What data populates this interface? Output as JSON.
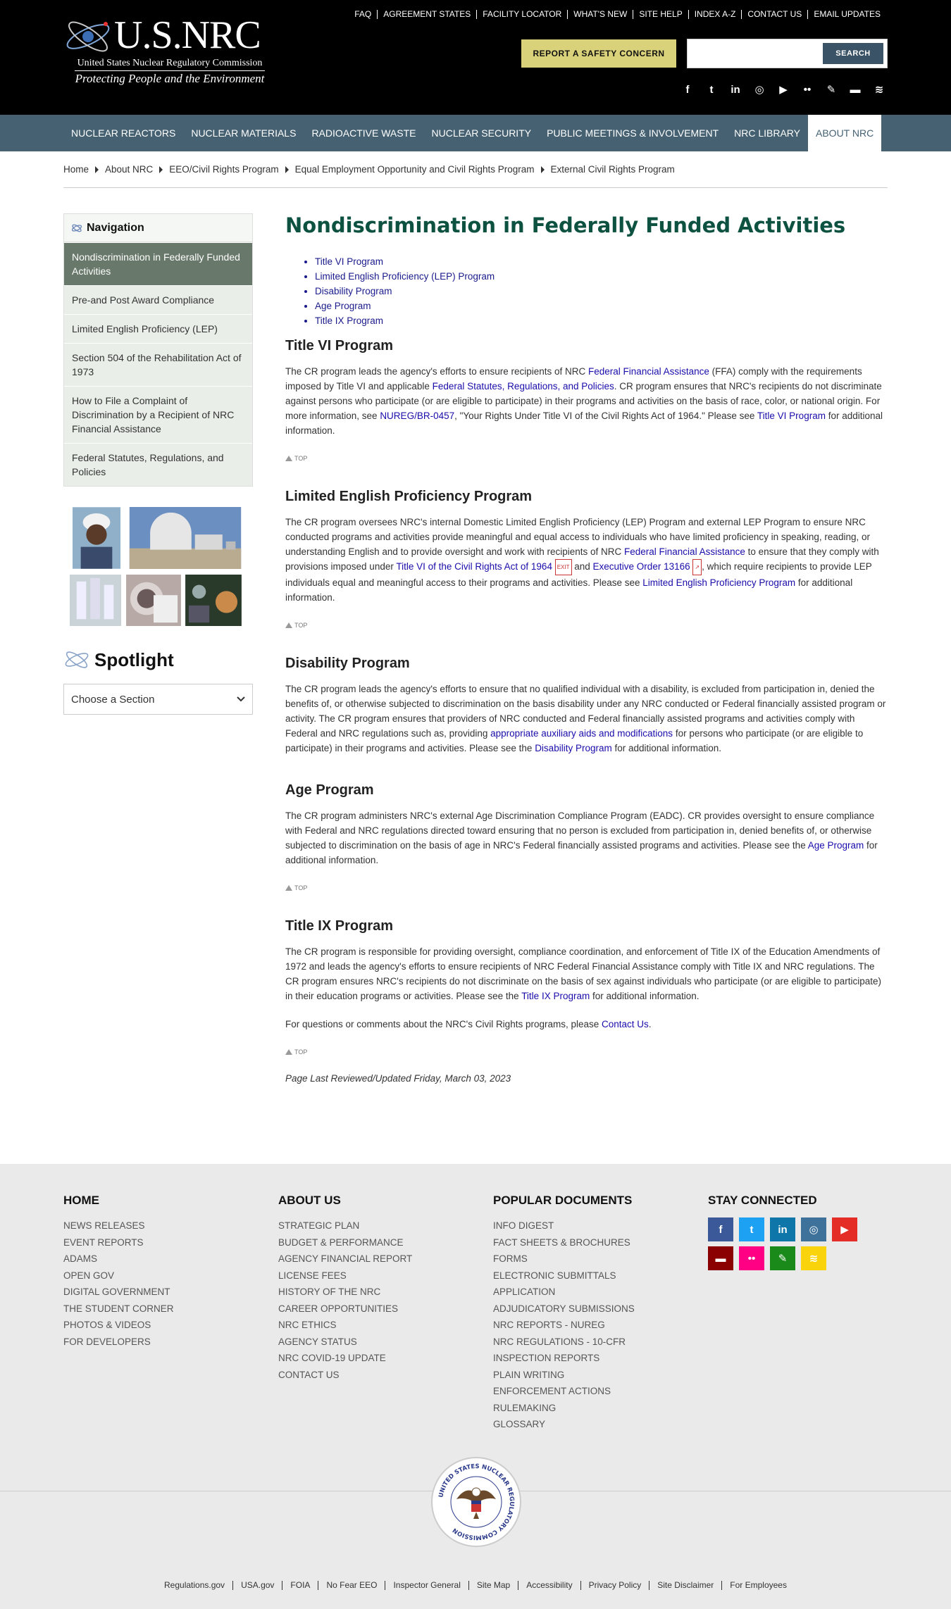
{
  "header": {
    "logo_title": "U.S.NRC",
    "logo_subtitle": "United States Nuclear Regulatory Commission",
    "logo_tagline": "Protecting People and the Environment",
    "utility_links": [
      "FAQ",
      "AGREEMENT STATES",
      "FACILITY LOCATOR",
      "WHAT'S NEW",
      "SITE HELP",
      "INDEX A-Z",
      "CONTACT US",
      "EMAIL UPDATES"
    ],
    "report_button": "REPORT A SAFETY CONCERN",
    "search_placeholder": "",
    "search_button": "SEARCH",
    "social_icons": [
      "facebook-icon",
      "twitter-icon",
      "linkedin-icon",
      "instagram-icon",
      "youtube-icon",
      "flickr-icon",
      "blog-icon",
      "chat-icon",
      "rss-icon"
    ]
  },
  "navbar": {
    "items": [
      "NUCLEAR REACTORS",
      "NUCLEAR MATERIALS",
      "RADIOACTIVE WASTE",
      "NUCLEAR SECURITY",
      "PUBLIC MEETINGS & INVOLVEMENT",
      "NRC LIBRARY",
      "ABOUT NRC"
    ],
    "active_index": 6
  },
  "breadcrumb": [
    "Home",
    "About NRC",
    "EEO/Civil Rights Program",
    "Equal Employment Opportunity and Civil Rights Program",
    "External Civil Rights Program"
  ],
  "sidebar": {
    "nav_title": "Navigation",
    "links": [
      "Nondiscrimination in Federally Funded Activities",
      "Pre-and Post Award Compliance",
      "Limited English Proficiency (LEP)",
      "Section 504 of the Rehabilitation Act of 1973",
      "How to File a Complaint of Discrimination by a Recipient of NRC Financial Assistance",
      "Federal Statutes, Regulations, and Policies"
    ],
    "spotlight_title": "Spotlight",
    "spotlight_select": "Choose a Section"
  },
  "content": {
    "title": "Nondiscrimination in Federally Funded Activities",
    "toc": [
      "Title VI Program",
      "Limited English Proficiency (LEP) Program",
      "Disability Program",
      "Age Program",
      "Title IX Program"
    ],
    "top_label": "TOP",
    "ext_label": "EXIT",
    "title6": {
      "heading": "Title VI Program",
      "t1": "The CR program leads the agency's efforts to ensure recipients of NRC ",
      "l1": "Federal Financial Assistance",
      "t2": " (FFA) comply with the requirements imposed by Title VI and applicable ",
      "l2": "Federal Statutes, Regulations, and Policies",
      "t3": ". CR program ensures that NRC's recipients do not discriminate against persons who participate (or are eligible to participate) in their programs and activities on the basis of race, color, or national origin. For more information, see ",
      "l3": "NUREG/BR-0457",
      "t4": ", \"Your Rights Under Title VI of the Civil Rights Act of 1964.\"  Please see ",
      "l4": "Title VI Program",
      "t5": " for additional information."
    },
    "lep": {
      "heading": "Limited English Proficiency Program",
      "t1": "The CR program oversees NRC's internal Domestic Limited English Proficiency (LEP) Program and external LEP Program to ensure NRC conducted programs and activities provide meaningful and equal access to individuals who have limited proficiency in speaking, reading, or understanding English and to provide oversight and work with recipients of NRC ",
      "l1": "Federal Financial Assistance",
      "t2": " to ensure that they comply with provisions imposed under ",
      "l2": "Title VI of the Civil Rights Act of 1964",
      "t3": " and ",
      "l3": "Executive Order 13166",
      "t4": ", which require recipients to provide LEP individuals equal and meaningful access to their programs and activities. Please see ",
      "l4": "Limited English Proficiency Program",
      "t5": " for additional information."
    },
    "disability": {
      "heading": "Disability Program",
      "t1": "The CR program leads the agency's efforts to ensure that no qualified individual with a disability, is excluded from participation in, denied the benefits of, or otherwise subjected to discrimination on the basis disability under any NRC conducted or Federal financially assisted program or activity. The CR program ensures that providers of NRC conducted and Federal financially assisted programs and activities comply with Federal and NRC regulations such as, providing ",
      "l1": "appropriate auxiliary aids and modifications",
      "t2": " for persons who participate (or are eligible to participate) in their programs and activities.  Please see the ",
      "l2": "Disability Program",
      "t3": " for additional information."
    },
    "age": {
      "heading": "Age Program",
      "t1": "The CR program administers NRC's external Age Discrimination Compliance Program (EADC).  CR provides oversight to ensure compliance with Federal and NRC regulations directed toward ensuring that no person is excluded from participation in, denied benefits of, or otherwise subjected to discrimination on the basis of age in NRC's Federal financially assisted programs and activities.  Please see the ",
      "l1": "Age Program",
      "t2": " for additional information."
    },
    "title9": {
      "heading": "Title IX Program",
      "t1": "The CR program is responsible for providing oversight, compliance coordination, and enforcement of Title IX of the Education Amendments of 1972 and leads the agency's efforts to ensure recipients of NRC Federal Financial Assistance comply with Title IX and NRC regulations. The CR program ensures NRC's recipients do not discriminate on the basis of sex against individuals who participate (or are eligible to participate) in their education programs or activities. Please see the ",
      "l1": "Title IX Program",
      "t2": " for additional information.",
      "q1": "For questions or comments about the NRC's Civil Rights programs, please ",
      "ql": "Contact Us",
      "q2": "."
    },
    "last_reviewed": "Page Last Reviewed/Updated Friday, March 03, 2023"
  },
  "footer": {
    "home": {
      "heading": "HOME",
      "links": [
        "NEWS RELEASES",
        "EVENT REPORTS",
        "ADAMS",
        "OPEN GOV",
        "DIGITAL GOVERNMENT",
        "THE STUDENT CORNER",
        "PHOTOS & VIDEOS",
        "FOR DEVELOPERS"
      ]
    },
    "about": {
      "heading": "ABOUT US",
      "links": [
        "STRATEGIC PLAN",
        "BUDGET & PERFORMANCE",
        "AGENCY FINANCIAL REPORT",
        "LICENSE FEES",
        "HISTORY OF THE NRC",
        "CAREER OPPORTUNITIES",
        "NRC ETHICS",
        "AGENCY STATUS",
        "NRC COVID-19 UPDATE",
        "CONTACT US"
      ]
    },
    "docs": {
      "heading": "POPULAR DOCUMENTS",
      "links": [
        "INFO DIGEST",
        "FACT SHEETS & BROCHURES",
        "FORMS",
        "ELECTRONIC SUBMITTALS",
        "APPLICATION",
        "ADJUDICATORY SUBMISSIONS",
        "NRC REPORTS - NUREG",
        "NRC REGULATIONS - 10-CFR",
        "INSPECTION REPORTS",
        "PLAIN WRITING",
        "ENFORCEMENT ACTIONS",
        "RULEMAKING",
        "GLOSSARY"
      ]
    },
    "connect": {
      "heading": "STAY CONNECTED",
      "icons": [
        {
          "name": "facebook-icon",
          "glyph": "f",
          "color": "#3b5998"
        },
        {
          "name": "twitter-icon",
          "glyph": "t",
          "color": "#1da1f2"
        },
        {
          "name": "linkedin-icon",
          "glyph": "in",
          "color": "#0e76a8"
        },
        {
          "name": "instagram-icon",
          "glyph": "◎",
          "color": "#3f729b"
        },
        {
          "name": "youtube-icon",
          "glyph": "▶",
          "color": "#e52d27"
        },
        {
          "name": "chat-icon",
          "glyph": "▬",
          "color": "#8b0000"
        },
        {
          "name": "flickr-icon",
          "glyph": "••",
          "color": "#ff0084"
        },
        {
          "name": "blog-icon",
          "glyph": "✎",
          "color": "#1a8a1a"
        },
        {
          "name": "rss-icon",
          "glyph": "≋",
          "color": "#f9d30b"
        }
      ]
    },
    "seal_text": "UNITED STATES NUCLEAR REGULATORY COMMISSION",
    "legal_links": [
      "Regulations.gov",
      "USA.gov",
      "FOIA",
      "No Fear EEO",
      "Inspector General",
      "Site Map",
      "Accessibility",
      "Privacy Policy",
      "Site Disclaimer",
      "For Employees"
    ]
  }
}
